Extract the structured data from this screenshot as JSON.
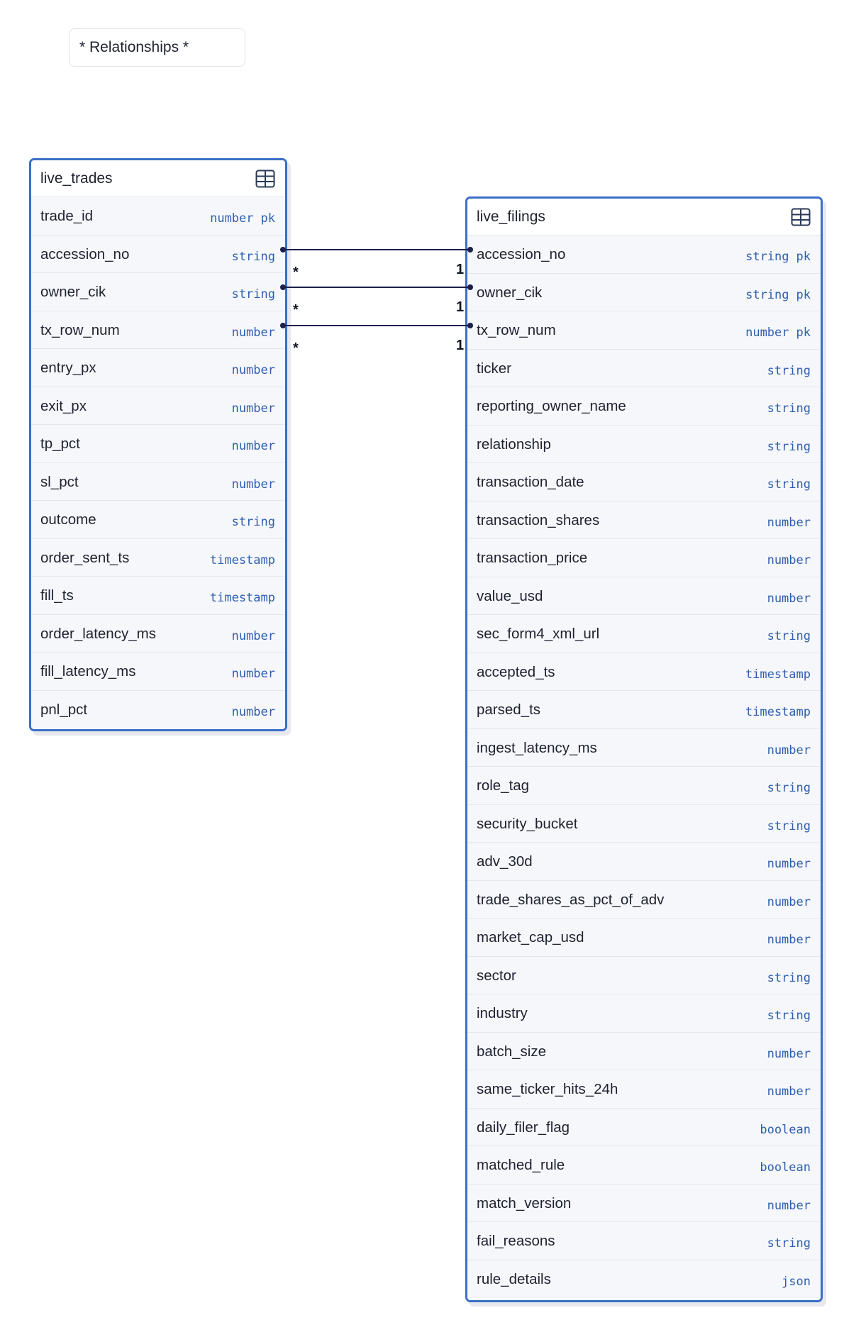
{
  "section_label": "* Relationships *",
  "colors": {
    "table_border": "#3a6fc7",
    "type_text": "#2f5fae",
    "connector": "#1c1f4a"
  },
  "tables": {
    "live_trades": {
      "name": "live_trades",
      "icon": "table-grid-icon",
      "columns": [
        {
          "name": "trade_id",
          "type": "number",
          "pk": "pk"
        },
        {
          "name": "accession_no",
          "type": "string",
          "pk": ""
        },
        {
          "name": "owner_cik",
          "type": "string",
          "pk": ""
        },
        {
          "name": "tx_row_num",
          "type": "number",
          "pk": ""
        },
        {
          "name": "entry_px",
          "type": "number",
          "pk": ""
        },
        {
          "name": "exit_px",
          "type": "number",
          "pk": ""
        },
        {
          "name": "tp_pct",
          "type": "number",
          "pk": ""
        },
        {
          "name": "sl_pct",
          "type": "number",
          "pk": ""
        },
        {
          "name": "outcome",
          "type": "string",
          "pk": ""
        },
        {
          "name": "order_sent_ts",
          "type": "timestamp",
          "pk": ""
        },
        {
          "name": "fill_ts",
          "type": "timestamp",
          "pk": ""
        },
        {
          "name": "order_latency_ms",
          "type": "number",
          "pk": ""
        },
        {
          "name": "fill_latency_ms",
          "type": "number",
          "pk": ""
        },
        {
          "name": "pnl_pct",
          "type": "number",
          "pk": ""
        }
      ]
    },
    "live_filings": {
      "name": "live_filings",
      "icon": "table-grid-icon",
      "columns": [
        {
          "name": "accession_no",
          "type": "string",
          "pk": "pk"
        },
        {
          "name": "owner_cik",
          "type": "string",
          "pk": "pk"
        },
        {
          "name": "tx_row_num",
          "type": "number",
          "pk": "pk"
        },
        {
          "name": "ticker",
          "type": "string",
          "pk": ""
        },
        {
          "name": "reporting_owner_name",
          "type": "string",
          "pk": ""
        },
        {
          "name": "relationship",
          "type": "string",
          "pk": ""
        },
        {
          "name": "transaction_date",
          "type": "string",
          "pk": ""
        },
        {
          "name": "transaction_shares",
          "type": "number",
          "pk": ""
        },
        {
          "name": "transaction_price",
          "type": "number",
          "pk": ""
        },
        {
          "name": "value_usd",
          "type": "number",
          "pk": ""
        },
        {
          "name": "sec_form4_xml_url",
          "type": "string",
          "pk": ""
        },
        {
          "name": "accepted_ts",
          "type": "timestamp",
          "pk": ""
        },
        {
          "name": "parsed_ts",
          "type": "timestamp",
          "pk": ""
        },
        {
          "name": "ingest_latency_ms",
          "type": "number",
          "pk": ""
        },
        {
          "name": "role_tag",
          "type": "string",
          "pk": ""
        },
        {
          "name": "security_bucket",
          "type": "string",
          "pk": ""
        },
        {
          "name": "adv_30d",
          "type": "number",
          "pk": ""
        },
        {
          "name": "trade_shares_as_pct_of_adv",
          "type": "number",
          "pk": ""
        },
        {
          "name": "market_cap_usd",
          "type": "number",
          "pk": ""
        },
        {
          "name": "sector",
          "type": "string",
          "pk": ""
        },
        {
          "name": "industry",
          "type": "string",
          "pk": ""
        },
        {
          "name": "batch_size",
          "type": "number",
          "pk": ""
        },
        {
          "name": "same_ticker_hits_24h",
          "type": "number",
          "pk": ""
        },
        {
          "name": "daily_filer_flag",
          "type": "boolean",
          "pk": ""
        },
        {
          "name": "matched_rule",
          "type": "boolean",
          "pk": ""
        },
        {
          "name": "match_version",
          "type": "number",
          "pk": ""
        },
        {
          "name": "fail_reasons",
          "type": "string",
          "pk": ""
        },
        {
          "name": "rule_details",
          "type": "json",
          "pk": ""
        }
      ]
    }
  },
  "relationships": [
    {
      "from_table": "live_trades",
      "from_column": "accession_no",
      "from_card": "*",
      "to_table": "live_filings",
      "to_column": "accession_no",
      "to_card": "1"
    },
    {
      "from_table": "live_trades",
      "from_column": "owner_cik",
      "from_card": "*",
      "to_table": "live_filings",
      "to_column": "owner_cik",
      "to_card": "1"
    },
    {
      "from_table": "live_trades",
      "from_column": "tx_row_num",
      "from_card": "*",
      "to_table": "live_filings",
      "to_column": "tx_row_num",
      "to_card": "1"
    }
  ]
}
